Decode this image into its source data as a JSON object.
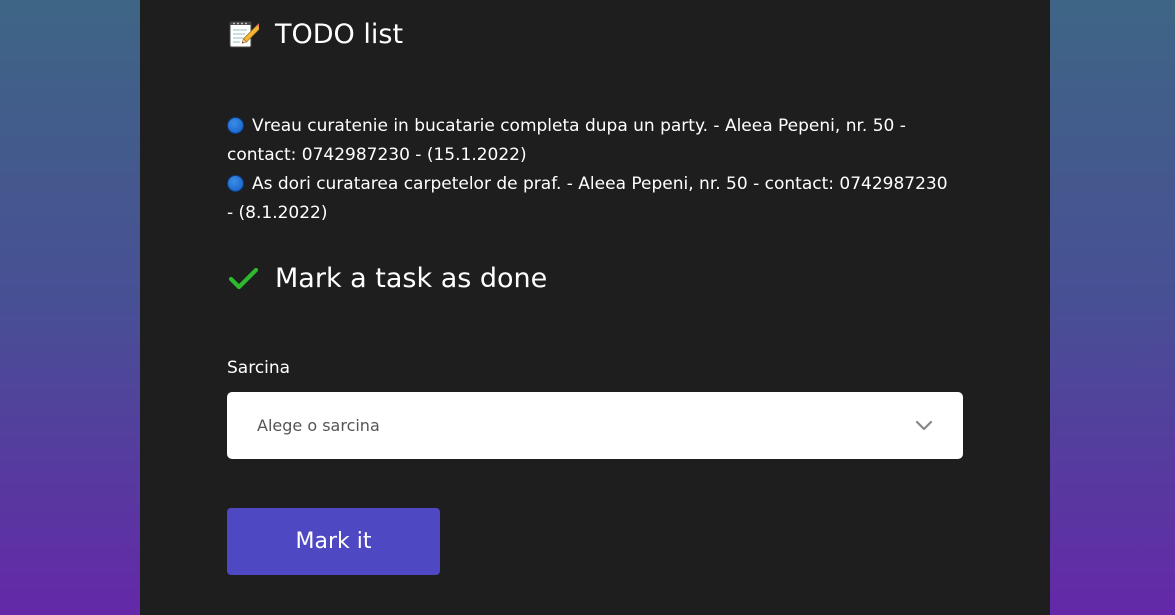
{
  "todo_section": {
    "icon": "memo-icon",
    "title": "TODO list"
  },
  "tasks": [
    {
      "icon": "blue-circle-icon",
      "text": "Vreau curatenie in bucatarie completa dupa un party. - Aleea Pepeni, nr. 50 - contact: 0742987230 - (15.1.2022)"
    },
    {
      "icon": "blue-circle-icon",
      "text": "As dori curatarea carpetelor de praf. - Aleea Pepeni, nr. 50 - contact: 0742987230 - (8.1.2022)"
    }
  ],
  "done_section": {
    "icon": "check-mark-icon",
    "title": "Mark a task as done"
  },
  "form": {
    "label": "Sarcina",
    "select_placeholder": "Alege o sarcina",
    "submit_label": "Mark it"
  },
  "colors": {
    "card_background": "#1e1e1e",
    "button_background": "#4f48c3",
    "bullet": "#1e6cd0",
    "check": "#2db82d"
  }
}
